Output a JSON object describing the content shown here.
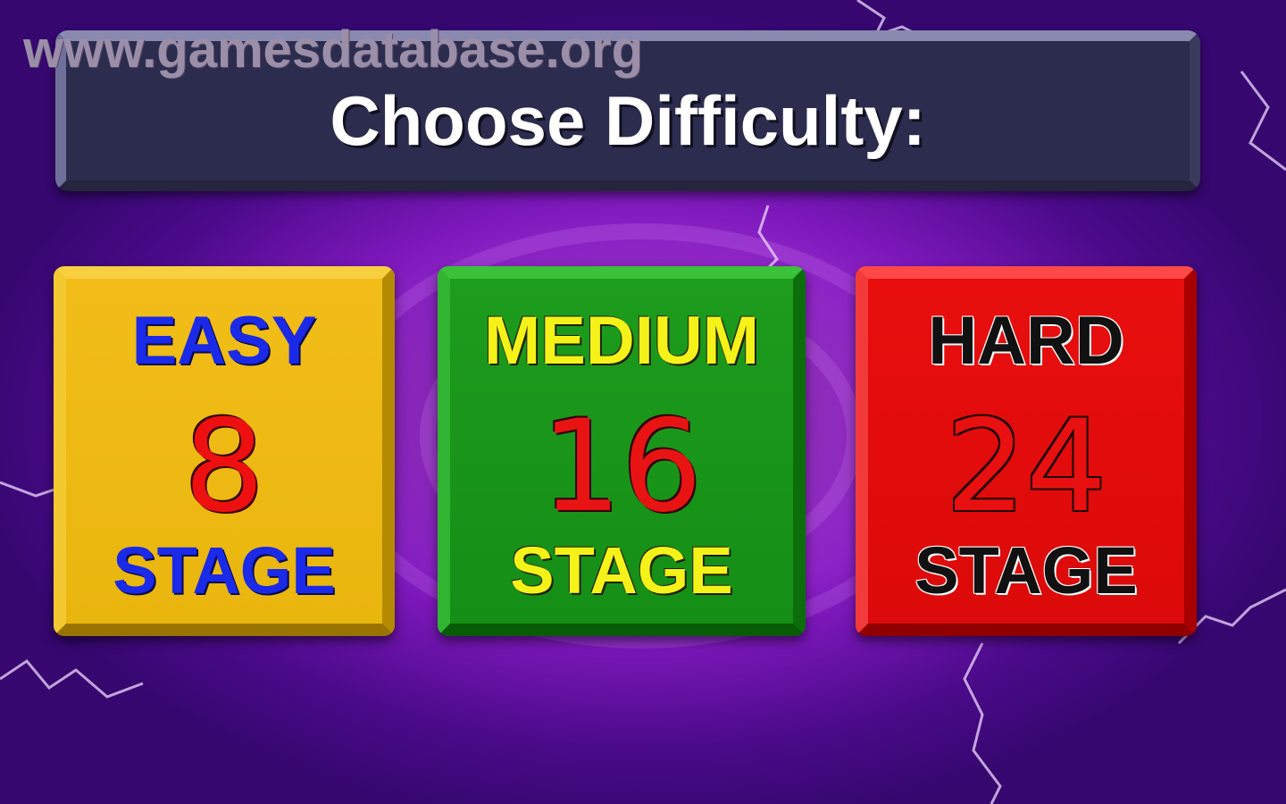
{
  "watermark": "www.gamesdatabase.org",
  "title": "Choose Difficulty:",
  "options": [
    {
      "label": "EASY",
      "number": "8",
      "stage": "STAGE"
    },
    {
      "label": "MEDIUM",
      "number": "16",
      "stage": "STAGE"
    },
    {
      "label": "HARD",
      "number": "24",
      "stage": "STAGE"
    }
  ],
  "colors": {
    "background": "#7b17b9",
    "banner": "#2c2c4e",
    "easy": "#e9b60e",
    "medium": "#158e15",
    "hard": "#dc0a0a"
  }
}
